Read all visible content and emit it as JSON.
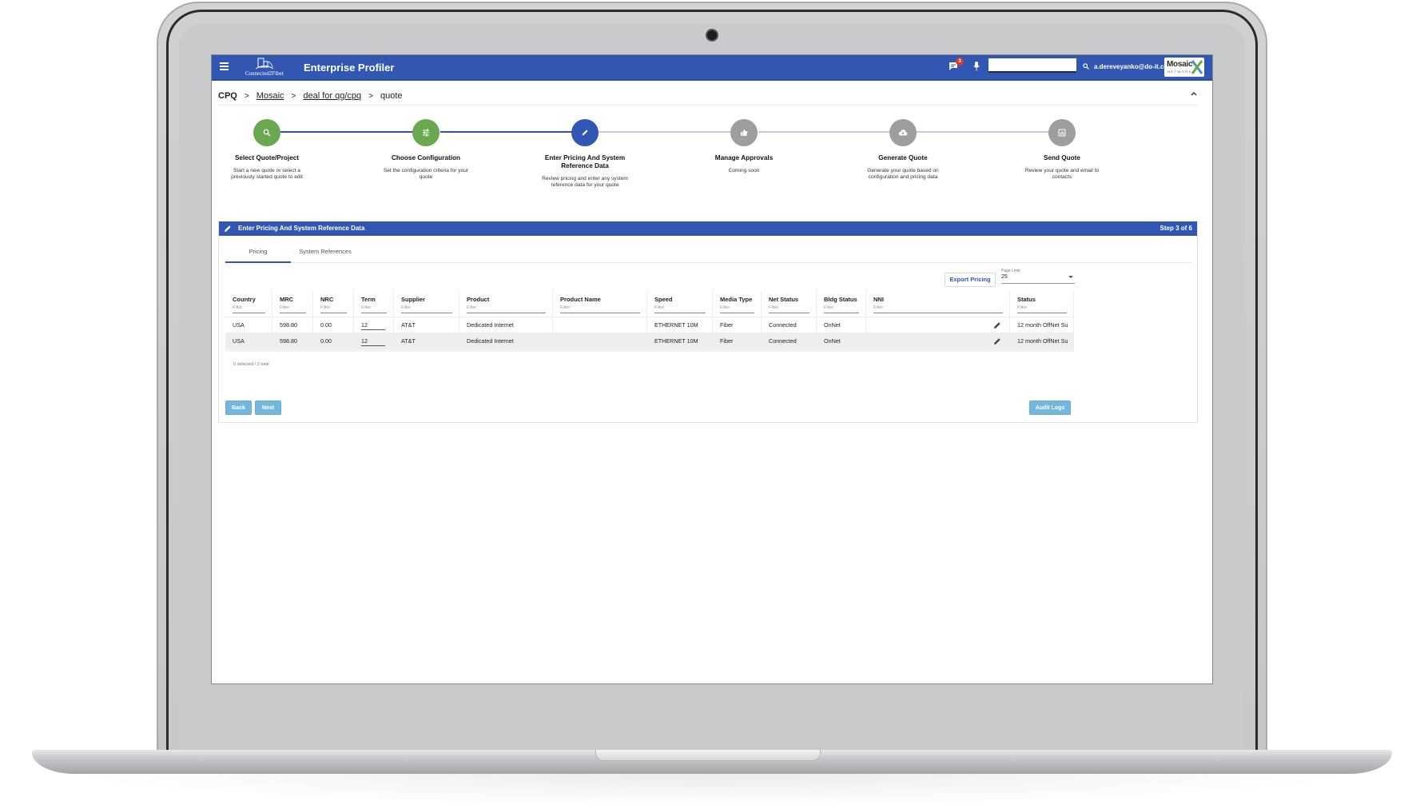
{
  "app": {
    "title": "Enterprise Profiler",
    "logo_text": "Connected2Fiber",
    "notification_count": "3",
    "search_value": "",
    "user_email": "a.dereveyanko@do-it.co",
    "brand_name": "Mosaic",
    "brand_sub": "NETWORK"
  },
  "breadcrumb": {
    "root": "CPQ",
    "items": [
      "Mosaic",
      "deal for qg/cpq"
    ],
    "current": "quote",
    "separator": ">"
  },
  "stepper": {
    "steps": [
      {
        "title": "Select Quote/Project",
        "desc": "Start a new quote or select a previously started quote to edit",
        "icon": "search-icon",
        "state": "complete"
      },
      {
        "title": "Choose Configuration",
        "desc": "Set the configuration criteria for your quote",
        "icon": "tune-icon",
        "state": "complete"
      },
      {
        "title": "Enter Pricing And System Reference Data",
        "desc": "Review pricing and enter any system reference data for your quote",
        "icon": "pencil-icon",
        "state": "active"
      },
      {
        "title": "Manage Approvals",
        "desc": "Coming soon",
        "icon": "thumbs-up-icon",
        "state": "pending"
      },
      {
        "title": "Generate Quote",
        "desc": "Generate your quote based on configuration and pricing data",
        "icon": "cloud-download-icon",
        "state": "pending"
      },
      {
        "title": "Send Quote",
        "desc": "Review your quote and email to contacts",
        "icon": "chart-icon",
        "state": "pending"
      }
    ]
  },
  "section": {
    "title": "Enter Pricing And System Reference Data",
    "step_count": "Step 3 of 6",
    "tabs": [
      "Pricing",
      "System References"
    ],
    "active_tab": "Pricing",
    "export_label": "Export Pricing",
    "page_limit_label": "Page Limit",
    "page_limit_value": "25"
  },
  "grid": {
    "filter_placeholder": "Filter",
    "columns": [
      "Country",
      "MRC",
      "NRC",
      "Term",
      "Supplier",
      "Product",
      "Product Name",
      "Speed",
      "Media Type",
      "Net Status",
      "Bldg Status",
      "NNI",
      "Status"
    ],
    "rows": [
      [
        "USA",
        "598.80",
        "0.00",
        "12",
        "AT&T",
        "Dedicated Internet",
        "",
        "ETHERNET 10M",
        "Fiber",
        "Connected",
        "OnNet",
        "",
        "12 month OffNet Su"
      ],
      [
        "USA",
        "598.80",
        "0.00",
        "12",
        "AT&T",
        "Dedicated Internet",
        "",
        "ETHERNET 10M",
        "Fiber",
        "Connected",
        "OnNet",
        "",
        "12 month OffNet Su"
      ]
    ],
    "selection_summary": "0 selected / 2 total"
  },
  "actions": {
    "back": "Back",
    "next": "Next",
    "audit_logs": "Audit Logs"
  },
  "colors": {
    "primary": "#3257b3",
    "complete": "#6aa84f",
    "pending": "#9e9e9e",
    "button": "#74b7dd",
    "badge": "#d63b32"
  }
}
